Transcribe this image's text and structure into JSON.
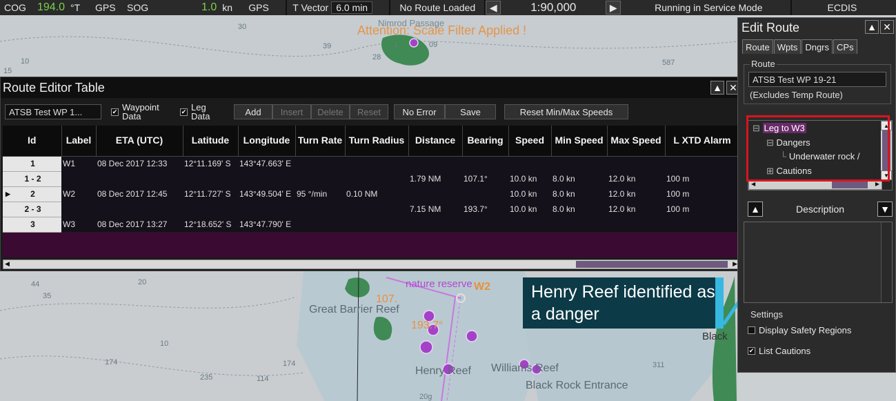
{
  "topbar": {
    "cog_label": "COG",
    "cog_value": "194.0",
    "cog_unit": "°T",
    "cog_source": "GPS",
    "sog_label": "SOG",
    "sog_value": "1.0",
    "sog_unit": "kn",
    "sog_source": "GPS",
    "tvector_label": "T Vector",
    "tvector_value": "6.0 min",
    "route_status": "No Route Loaded",
    "scale": "1:90,000",
    "mode": "Running in Service Mode",
    "app": "ECDIS",
    "left_arrow": "◀",
    "right_arrow": "▶"
  },
  "chart": {
    "scale_filter_notice": "Attention: Scale Filter Applied !",
    "place_names": [
      "Nimrod Passage",
      "nature reserve",
      "Great Barrier Reef",
      "Henry Reef",
      "Williams Reef",
      "Black Rock Entrance",
      "Black"
    ],
    "waypoint_label": "W2",
    "bearing_labels": [
      "107.",
      "193.7°"
    ],
    "soundings": [
      "30",
      "39",
      "587",
      "15",
      "10",
      "44",
      "35",
      "10",
      "174",
      "20",
      "174",
      "235",
      "114",
      "311",
      "20g",
      "28",
      "1",
      "09"
    ]
  },
  "route_editor": {
    "title": "Route Editor Table",
    "route_name": "ATSB Test WP 1...",
    "waypoint_data_label": "Waypoint Data",
    "waypoint_data_checked": true,
    "leg_data_label": "Leg Data",
    "leg_data_checked": true,
    "buttons": {
      "add": "Add",
      "insert": "Insert",
      "delete": "Delete",
      "reset": "Reset",
      "no_error": "No Error",
      "save": "Save",
      "reset_speeds": "Reset Min/Max Speeds"
    },
    "columns": [
      "Id",
      "Label",
      "ETA (UTC)",
      "Latitude",
      "Longitude",
      "Turn Rate",
      "Turn Radius",
      "Distance",
      "Bearing",
      "Speed",
      "Min Speed",
      "Max Speed",
      "L XTD Alarm"
    ],
    "rows": [
      {
        "id": "1",
        "label": "W1",
        "eta": "08 Dec 2017 12:33",
        "lat": "12°11.169' S",
        "lon": "143°47.663' E",
        "turn_rate": "",
        "turn_radius": "",
        "distance": "",
        "bearing": "",
        "speed": "",
        "min_speed": "",
        "max_speed": "",
        "xtd": ""
      },
      {
        "id": "1 - 2",
        "label": "",
        "eta": "",
        "lat": "",
        "lon": "",
        "turn_rate": "",
        "turn_radius": "",
        "distance": "1.79 NM",
        "bearing": "107.1°",
        "speed": "10.0 kn",
        "min_speed": "8.0 kn",
        "max_speed": "12.0 kn",
        "xtd": "100 m"
      },
      {
        "id": "2",
        "label": "W2",
        "eta": "08 Dec 2017 12:45",
        "lat": "12°11.727' S",
        "lon": "143°49.504' E",
        "turn_rate": "95 °/min",
        "turn_radius": "0.10 NM",
        "distance": "",
        "bearing": "",
        "speed": "10.0 kn",
        "min_speed": "8.0 kn",
        "max_speed": "12.0 kn",
        "xtd": "100 m"
      },
      {
        "id": "2 - 3",
        "label": "",
        "eta": "",
        "lat": "",
        "lon": "",
        "turn_rate": "",
        "turn_radius": "",
        "distance": "7.15 NM",
        "bearing": "193.7°",
        "speed": "10.0 kn",
        "min_speed": "8.0 kn",
        "max_speed": "12.0 kn",
        "xtd": "100 m"
      },
      {
        "id": "3",
        "label": "W3",
        "eta": "08 Dec 2017 13:27",
        "lat": "12°18.652' S",
        "lon": "143°47.790' E",
        "turn_rate": "",
        "turn_radius": "",
        "distance": "",
        "bearing": "",
        "speed": "",
        "min_speed": "",
        "max_speed": "",
        "xtd": ""
      }
    ]
  },
  "edit_route": {
    "title": "Edit Route",
    "tabs": [
      "Route",
      "Wpts",
      "Dngrs",
      "CPs"
    ],
    "active_tab": "Dngrs",
    "route_group_label": "Route",
    "route_name": "ATSB Test WP 19-21",
    "route_note": "(Excludes Temp Route)",
    "tree": {
      "leg": "Leg to W3",
      "dangers": "Dangers",
      "danger_item": "Underwater rock /",
      "cautions": "Cautions"
    },
    "description_label": "Description",
    "settings_label": "Settings",
    "display_safety_regions": "Display Safety Regions",
    "display_safety_regions_checked": false,
    "list_cautions": "List Cautions",
    "list_cautions_checked": true
  },
  "annotation": {
    "callout_text": "Henry Reef identified as a danger",
    "callout_color": "#0c3a47",
    "arrow_color": "#37b8e0",
    "highlight_color": "#d9141e"
  },
  "colors": {
    "cog_sog_value": "#7bd24a",
    "chart_text_orange": "#e8903c",
    "route_magenta": "#b04ad0"
  }
}
